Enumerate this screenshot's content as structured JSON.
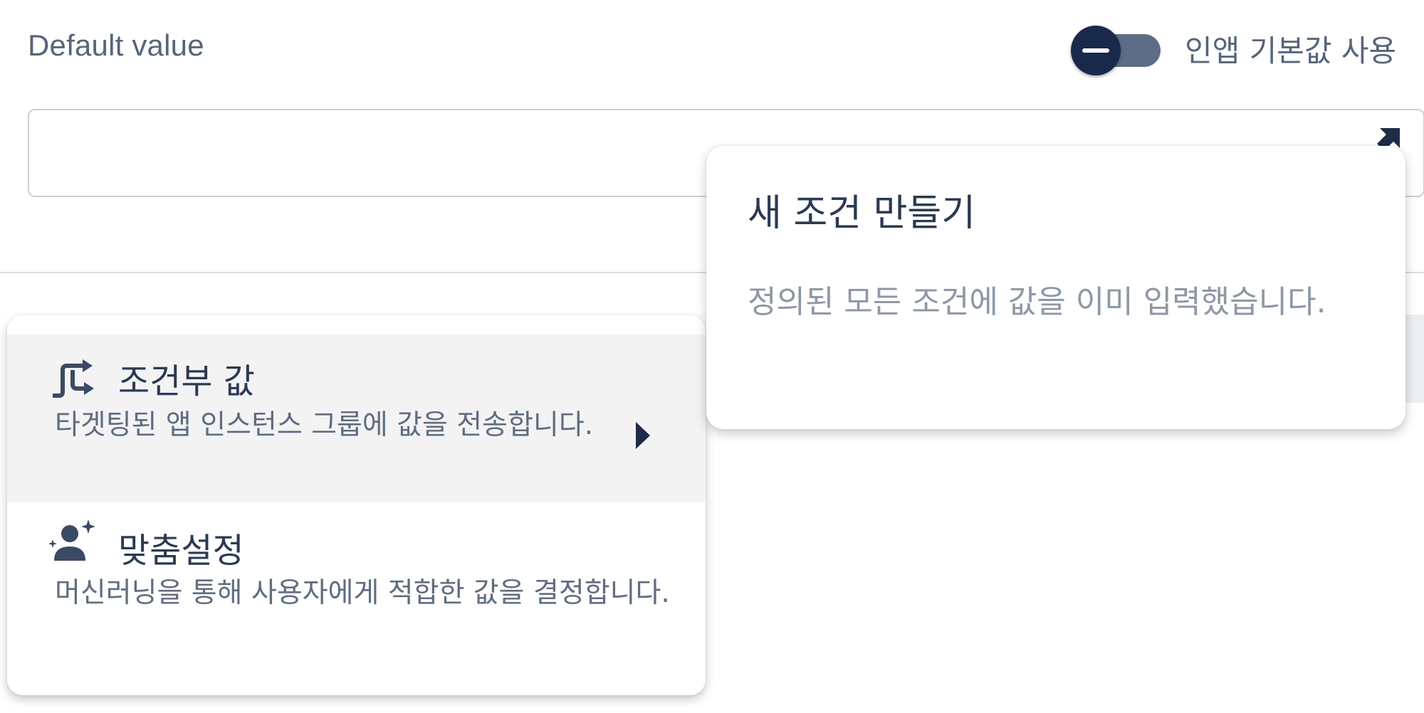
{
  "field": {
    "label": "Default value",
    "value": ""
  },
  "toggle": {
    "state": "on",
    "label": "인앱 기본값 사용"
  },
  "menu": {
    "items": [
      {
        "title": "조건부 값",
        "description": "타겟팅된 앱 인스턴스 그룹에 값을 전송합니다.",
        "icon": "conditional-value-icon",
        "has_submenu": true,
        "highlighted": true
      },
      {
        "title": "맞춤설정",
        "description": "머신러닝을 통해 사용자에게 적합한 값을 결정합니다.",
        "icon": "personalization-icon",
        "has_submenu": false,
        "highlighted": false
      }
    ]
  },
  "popover": {
    "title": "새 조건 만들기",
    "message": "정의된 모든 조건에 값을 이미 입력했습니다."
  },
  "colors": {
    "toggle_thumb": "#18294c",
    "toggle_track": "#5d6d87",
    "highlight": "#f3f3f3",
    "text_primary": "#2a3a55",
    "text_secondary": "#5f6d83",
    "text_muted": "#8c97a8"
  }
}
